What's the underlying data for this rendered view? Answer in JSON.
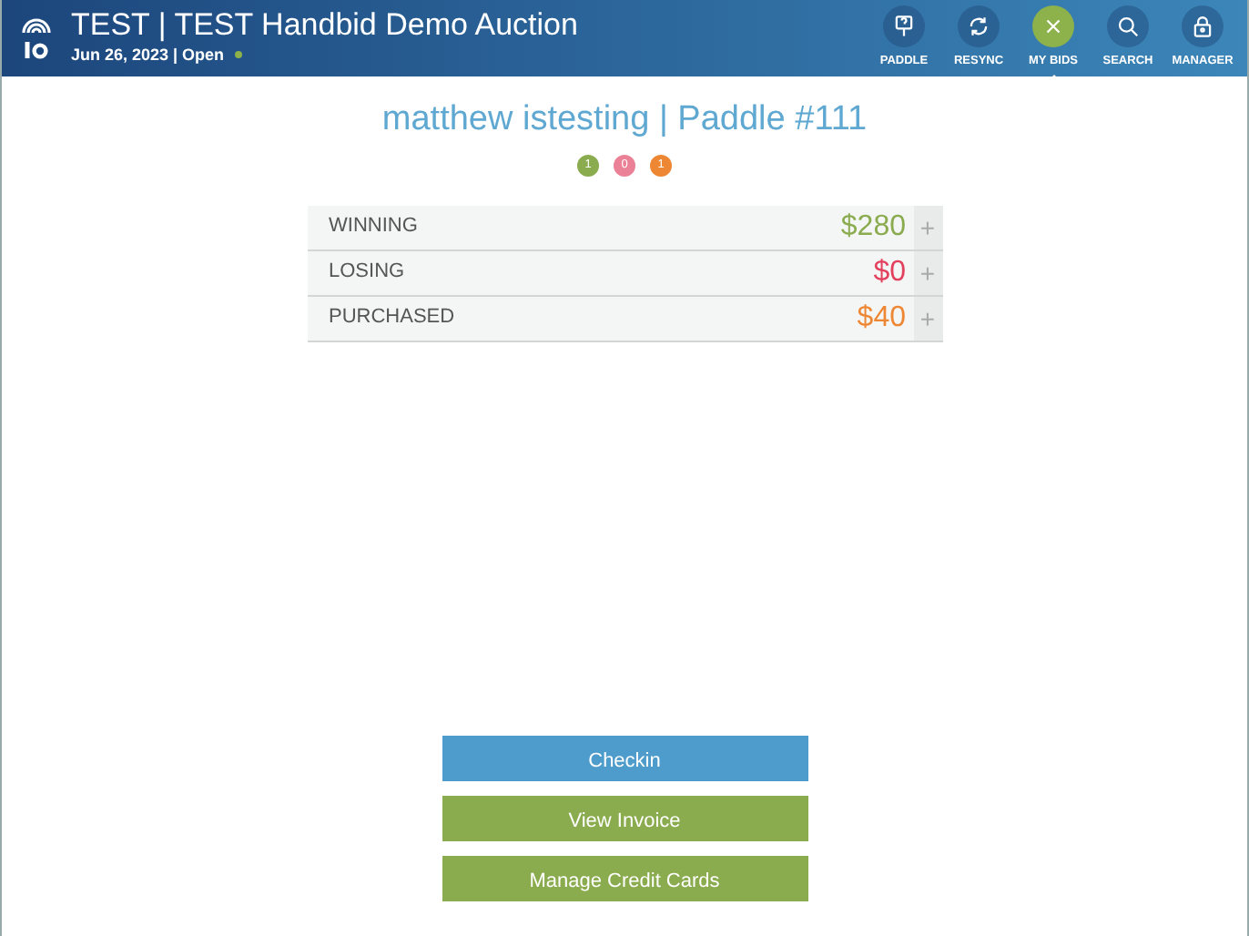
{
  "header": {
    "title": "TEST | TEST Handbid Demo Auction",
    "date": "Jun 26, 2023 | Open",
    "status": {
      "color": "#8db14b"
    }
  },
  "nav": [
    {
      "kind": "paddle",
      "label": "PADDLE",
      "selected": false
    },
    {
      "kind": "resync",
      "label": "RESYNC",
      "selected": false
    },
    {
      "kind": "close",
      "label": "MY BIDS",
      "selected": true
    },
    {
      "kind": "search",
      "label": "SEARCH",
      "selected": false
    },
    {
      "kind": "lock",
      "label": "MANAGER",
      "selected": false
    }
  ],
  "bidder": {
    "title": "matthew istesting | Paddle #111",
    "counts": [
      {
        "value": "1",
        "color": "#8aab4e"
      },
      {
        "value": "0",
        "color": "#ea8197"
      },
      {
        "value": "1",
        "color": "#ee8733"
      }
    ]
  },
  "sections": [
    {
      "label": "WINNING",
      "amount": "$280",
      "color": "#8aab4e",
      "expanded": false,
      "toggle": "+"
    },
    {
      "label": "LOSING",
      "amount": "$0",
      "color": "#e2405c",
      "expanded": false,
      "toggle": "+"
    },
    {
      "label": "PURCHASED",
      "amount": "$40",
      "color": "#ee8733",
      "expanded": false,
      "toggle": "+"
    }
  ],
  "buttons": [
    {
      "label": "Checkin",
      "color": "#4e9ccb"
    },
    {
      "label": "View Invoice",
      "color": "#8aab4e"
    },
    {
      "label": "Manage Credit Cards",
      "color": "#8aab4e"
    }
  ]
}
